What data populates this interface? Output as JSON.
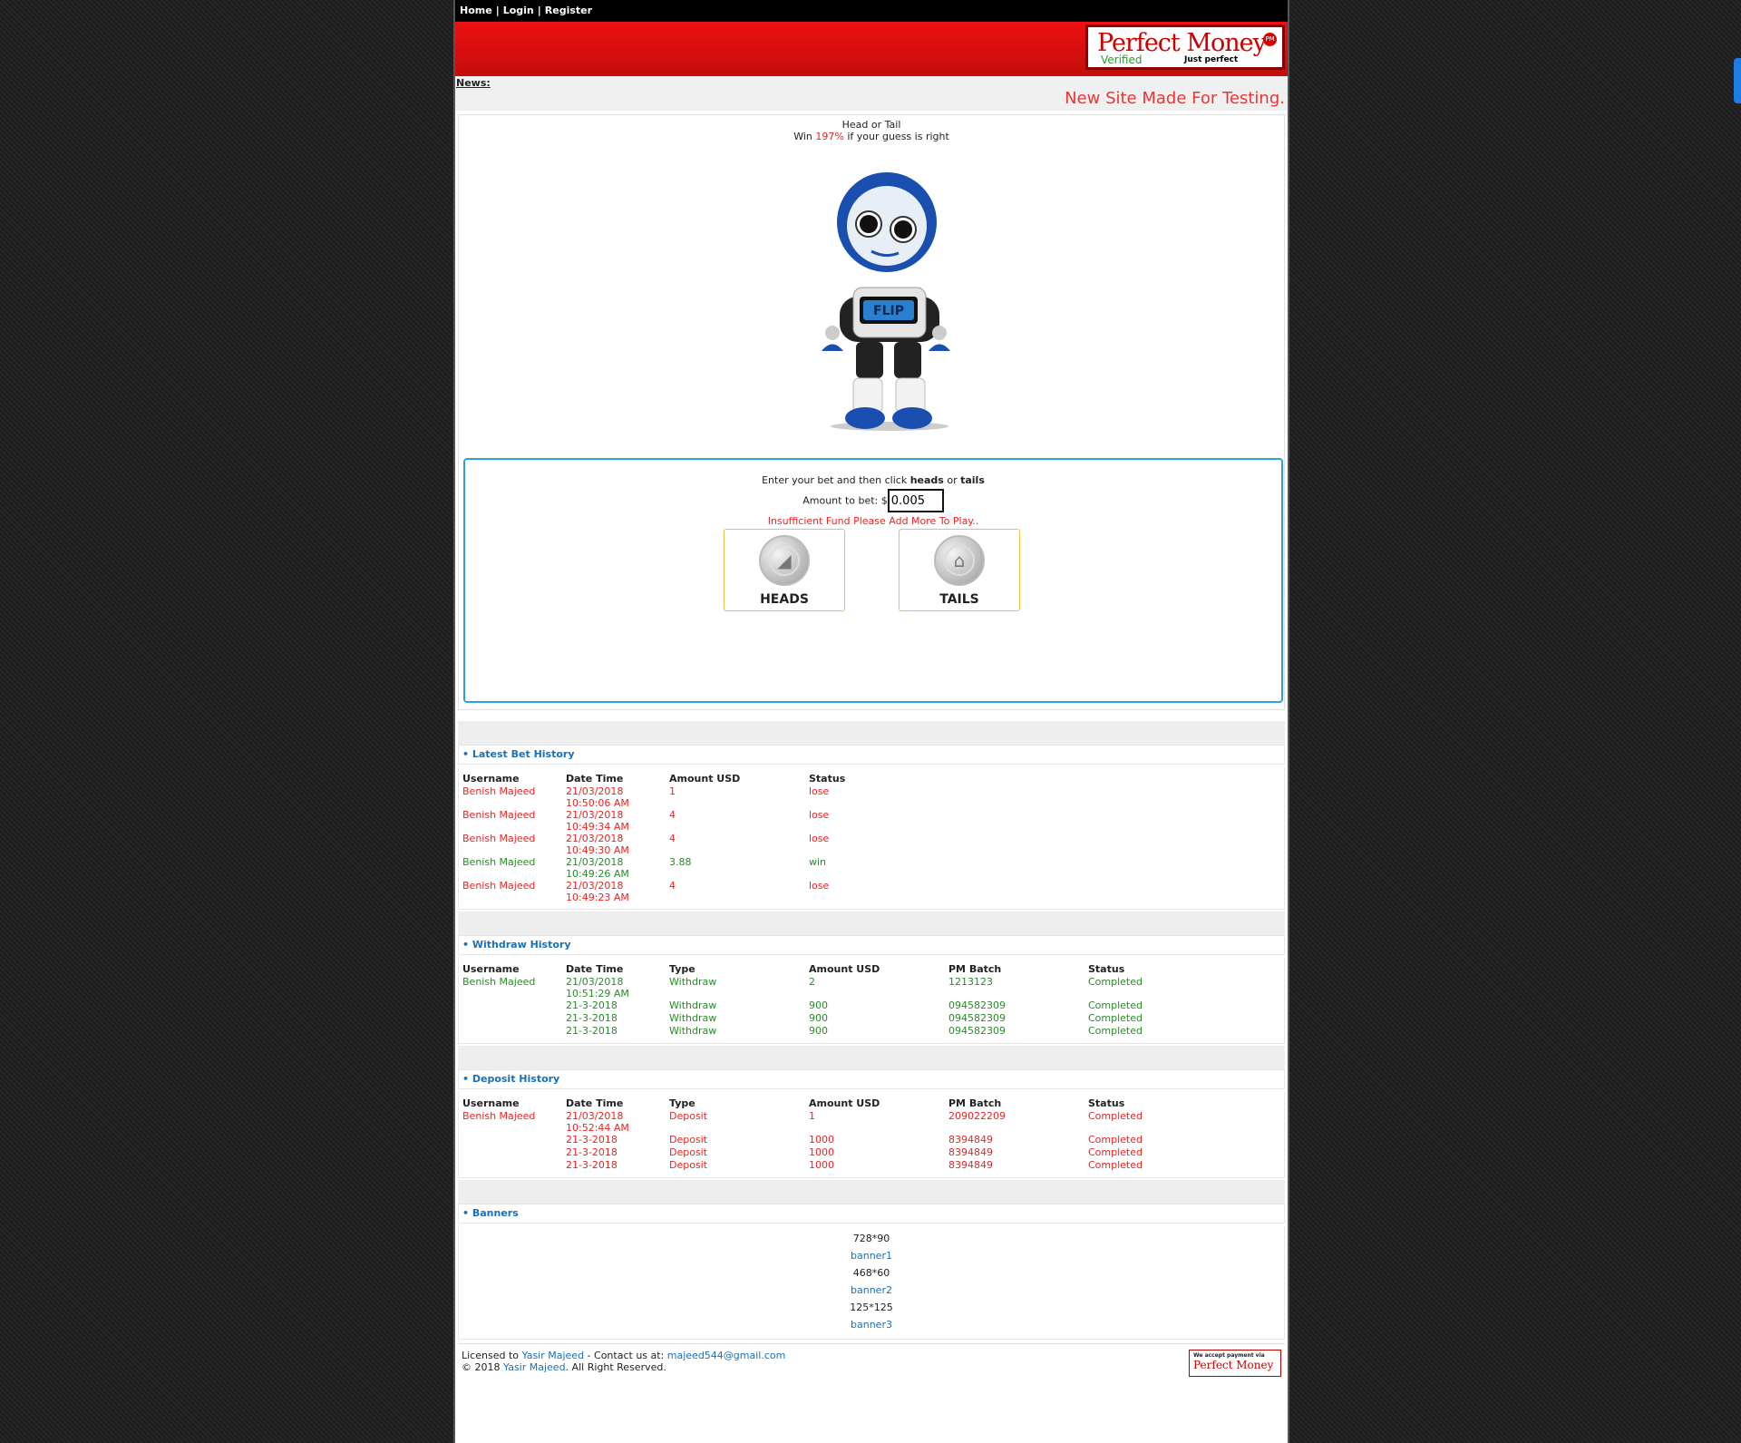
{
  "nav": {
    "home": "Home",
    "login": "Login",
    "register": "Register",
    "sep": "|"
  },
  "logo": {
    "title": "Perfect Money",
    "verified": "Verified",
    "tagline": "Just perfect",
    "badge": "PM"
  },
  "news": {
    "label": "News:",
    "text": "New Site Made For Testing."
  },
  "game": {
    "title": "Head or Tail",
    "win_prefix": "Win ",
    "win_pct": "197%",
    "win_suffix": " if your guess is right",
    "robot_label": "FLIP",
    "instr_prefix": "Enter your bet and then click ",
    "instr_heads": "heads",
    "instr_or": " or ",
    "instr_tails": "tails",
    "amount_label": "Amount to bet: $",
    "amount_value": "0.005",
    "error": "Insufficient Fund Please Add More To Play..",
    "heads_label": "HEADS",
    "tails_label": "TAILS"
  },
  "bet_history": {
    "title": "• Latest Bet History",
    "headers": [
      "Username",
      "Date Time",
      "Amount USD",
      "Status"
    ],
    "rows": [
      {
        "user": "Benish Majeed",
        "date": "21/03/2018",
        "time": "10:50:06 AM",
        "amount": "1",
        "status": "lose"
      },
      {
        "user": "Benish Majeed",
        "date": "21/03/2018",
        "time": "10:49:34 AM",
        "amount": "4",
        "status": "lose"
      },
      {
        "user": "Benish Majeed",
        "date": "21/03/2018",
        "time": "10:49:30 AM",
        "amount": "4",
        "status": "lose"
      },
      {
        "user": "Benish Majeed",
        "date": "21/03/2018",
        "time": "10:49:26 AM",
        "amount": "3.88",
        "status": "win"
      },
      {
        "user": "Benish Majeed",
        "date": "21/03/2018",
        "time": "10:49:23 AM",
        "amount": "4",
        "status": "lose"
      }
    ]
  },
  "withdraw_history": {
    "title": "• Withdraw History",
    "headers": [
      "Username",
      "Date Time",
      "Type",
      "Amount USD",
      "PM Batch",
      "Status"
    ],
    "rows": [
      {
        "user": "Benish Majeed",
        "date": "21/03/2018",
        "time": "10:51:29 AM",
        "type": "Withdraw",
        "amount": "2",
        "batch": "1213123",
        "status": "Completed"
      },
      {
        "user": "",
        "date": "21-3-2018",
        "time": "",
        "type": "Withdraw",
        "amount": "900",
        "batch": "094582309",
        "status": "Completed"
      },
      {
        "user": "",
        "date": "21-3-2018",
        "time": "",
        "type": "Withdraw",
        "amount": "900",
        "batch": "094582309",
        "status": "Completed"
      },
      {
        "user": "",
        "date": "21-3-2018",
        "time": "",
        "type": "Withdraw",
        "amount": "900",
        "batch": "094582309",
        "status": "Completed"
      }
    ]
  },
  "deposit_history": {
    "title": "• Deposit History",
    "headers": [
      "Username",
      "Date Time",
      "Type",
      "Amount USD",
      "PM Batch",
      "Status"
    ],
    "rows": [
      {
        "user": "Benish Majeed",
        "date": "21/03/2018",
        "time": "10:52:44 AM",
        "type": "Deposit",
        "amount": "1",
        "batch": "209022209",
        "status": "Completed"
      },
      {
        "user": "",
        "date": "21-3-2018",
        "time": "",
        "type": "Deposit",
        "amount": "1000",
        "batch": "8394849",
        "status": "Completed"
      },
      {
        "user": "",
        "date": "21-3-2018",
        "time": "",
        "type": "Deposit",
        "amount": "1000",
        "batch": "8394849",
        "status": "Completed"
      },
      {
        "user": "",
        "date": "21-3-2018",
        "time": "",
        "type": "Deposit",
        "amount": "1000",
        "batch": "8394849",
        "status": "Completed"
      }
    ]
  },
  "banners": {
    "title": "• Banners",
    "items": [
      {
        "size": "728*90",
        "link": "banner1"
      },
      {
        "size": "468*60",
        "link": "banner2"
      },
      {
        "size": "125*125",
        "link": "banner3"
      }
    ]
  },
  "footer": {
    "licensed": "Licensed to ",
    "owner": "Yasir Majeed",
    "contact": " - Contact us at: ",
    "email": "majeed544@gmail.com",
    "copy": "© 2018 ",
    "owner2": "Yasir Majeed",
    "rights": ". All Right Reserved.",
    "pm_accept": "We accept payment via",
    "pm_name": "Perfect Money"
  },
  "colors": {
    "accent_red": "#e22222",
    "link_blue": "#1a6fb7",
    "win_green": "#2a8a2a",
    "bet_border": "#29a3d8"
  }
}
